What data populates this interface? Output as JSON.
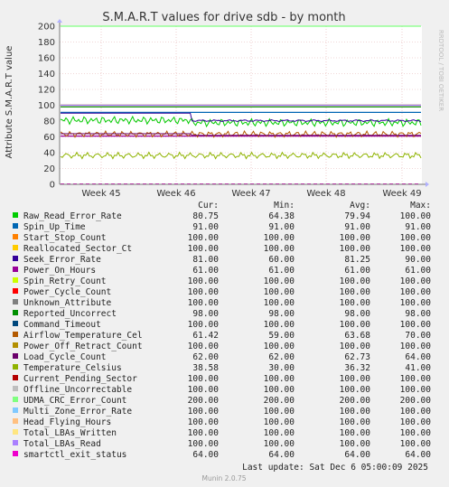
{
  "chart_data": {
    "type": "line",
    "title": "S.M.A.R.T values for drive sdb - by month",
    "ylabel": "Attribute S.M.A.R.T value",
    "ylim": [
      0,
      200
    ],
    "y_ticks": [
      "0",
      "20",
      "40",
      "60",
      "80",
      "100",
      "120",
      "140",
      "160",
      "180",
      "200"
    ],
    "x_ticks": [
      "Week 45",
      "Week 46",
      "Week 47",
      "Week 48",
      "Week 49"
    ],
    "grid": true,
    "side_label": "RRDTOOL / TOBI OETIKER",
    "legend_headers": {
      "cur": "Cur:",
      "min": "Min:",
      "avg": "Avg:",
      "max": "Max:"
    },
    "series": [
      {
        "name": "Raw_Read_Error_Rate",
        "color": "#00cc00",
        "cur": "80.75",
        "min": "64.38",
        "avg": "79.94",
        "max": "100.00"
      },
      {
        "name": "Spin_Up_Time",
        "color": "#0066b3",
        "cur": "91.00",
        "min": "91.00",
        "avg": "91.00",
        "max": "91.00"
      },
      {
        "name": "Start_Stop_Count",
        "color": "#ff8000",
        "cur": "100.00",
        "min": "100.00",
        "avg": "100.00",
        "max": "100.00"
      },
      {
        "name": "Reallocated_Sector_Ct",
        "color": "#ffcc00",
        "cur": "100.00",
        "min": "100.00",
        "avg": "100.00",
        "max": "100.00"
      },
      {
        "name": "Seek_Error_Rate",
        "color": "#330099",
        "cur": "81.00",
        "min": "60.00",
        "avg": "81.25",
        "max": "90.00"
      },
      {
        "name": "Power_On_Hours",
        "color": "#990099",
        "cur": "61.00",
        "min": "61.00",
        "avg": "61.00",
        "max": "61.00"
      },
      {
        "name": "Spin_Retry_Count",
        "color": "#ccff00",
        "cur": "100.00",
        "min": "100.00",
        "avg": "100.00",
        "max": "100.00"
      },
      {
        "name": "Power_Cycle_Count",
        "color": "#ff0000",
        "cur": "100.00",
        "min": "100.00",
        "avg": "100.00",
        "max": "100.00"
      },
      {
        "name": "Unknown_Attribute",
        "color": "#808080",
        "cur": "100.00",
        "min": "100.00",
        "avg": "100.00",
        "max": "100.00"
      },
      {
        "name": "Reported_Uncorrect",
        "color": "#008f00",
        "cur": "98.00",
        "min": "98.00",
        "avg": "98.00",
        "max": "98.00"
      },
      {
        "name": "Command_Timeout",
        "color": "#00487d",
        "cur": "100.00",
        "min": "100.00",
        "avg": "100.00",
        "max": "100.00"
      },
      {
        "name": "Airflow_Temperature_Cel",
        "color": "#b35a00",
        "cur": "61.42",
        "min": "59.00",
        "avg": "63.68",
        "max": "70.00"
      },
      {
        "name": "Power_Off_Retract_Count",
        "color": "#b38f00",
        "cur": "100.00",
        "min": "100.00",
        "avg": "100.00",
        "max": "100.00"
      },
      {
        "name": "Load_Cycle_Count",
        "color": "#6b006b",
        "cur": "62.00",
        "min": "62.00",
        "avg": "62.73",
        "max": "64.00"
      },
      {
        "name": "Temperature_Celsius",
        "color": "#8fb300",
        "cur": "38.58",
        "min": "30.00",
        "avg": "36.32",
        "max": "41.00"
      },
      {
        "name": "Current_Pending_Sector",
        "color": "#b30000",
        "cur": "100.00",
        "min": "100.00",
        "avg": "100.00",
        "max": "100.00"
      },
      {
        "name": "Offline_Uncorrectable",
        "color": "#bebebe",
        "cur": "100.00",
        "min": "100.00",
        "avg": "100.00",
        "max": "100.00"
      },
      {
        "name": "UDMA_CRC_Error_Count",
        "color": "#80ff80",
        "cur": "200.00",
        "min": "200.00",
        "avg": "200.00",
        "max": "200.00"
      },
      {
        "name": "Multi_Zone_Error_Rate",
        "color": "#80c9ff",
        "cur": "100.00",
        "min": "100.00",
        "avg": "100.00",
        "max": "100.00"
      },
      {
        "name": "Head_Flying_Hours",
        "color": "#ffc080",
        "cur": "100.00",
        "min": "100.00",
        "avg": "100.00",
        "max": "100.00"
      },
      {
        "name": "Total_LBAs_Written",
        "color": "#ffe680",
        "cur": "100.00",
        "min": "100.00",
        "avg": "100.00",
        "max": "100.00"
      },
      {
        "name": "Total_LBAs_Read",
        "color": "#aa80ff",
        "cur": "100.00",
        "min": "100.00",
        "avg": "100.00",
        "max": "100.00"
      },
      {
        "name": "smartctl_exit_status",
        "color": "#ee00cc",
        "cur": "64.00",
        "min": "64.00",
        "avg": "64.00",
        "max": "64.00"
      }
    ],
    "last_update": "Last update: Sat Dec  6 05:00:09 2025",
    "footer": "Munin 2.0.75"
  }
}
